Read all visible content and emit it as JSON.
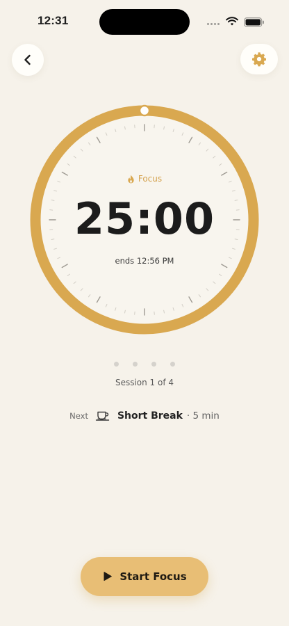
{
  "status_bar": {
    "time": "12:31",
    "icons": [
      "signal-dots-icon",
      "wifi-icon",
      "battery-icon"
    ]
  },
  "header": {
    "back_icon": "chevron-left-icon",
    "settings_icon": "gear-icon"
  },
  "timer": {
    "mode_icon": "flame-icon",
    "mode_label": "Focus",
    "display": "25:00",
    "ends_label": "ends 12:56 PM",
    "progress_fraction": 1.0
  },
  "session": {
    "total": 4,
    "current": 1,
    "label": "Session 1 of 4"
  },
  "next": {
    "prefix": "Next",
    "icon": "coffee-cup-icon",
    "name": "Short Break",
    "duration": "· 5 min"
  },
  "start_button": {
    "icon": "play-icon",
    "label": "Start Focus"
  },
  "colors": {
    "background": "#F6F2EA",
    "accent": "#D9A850",
    "button": "#E8BE75",
    "text_primary": "#1C1C1C"
  }
}
